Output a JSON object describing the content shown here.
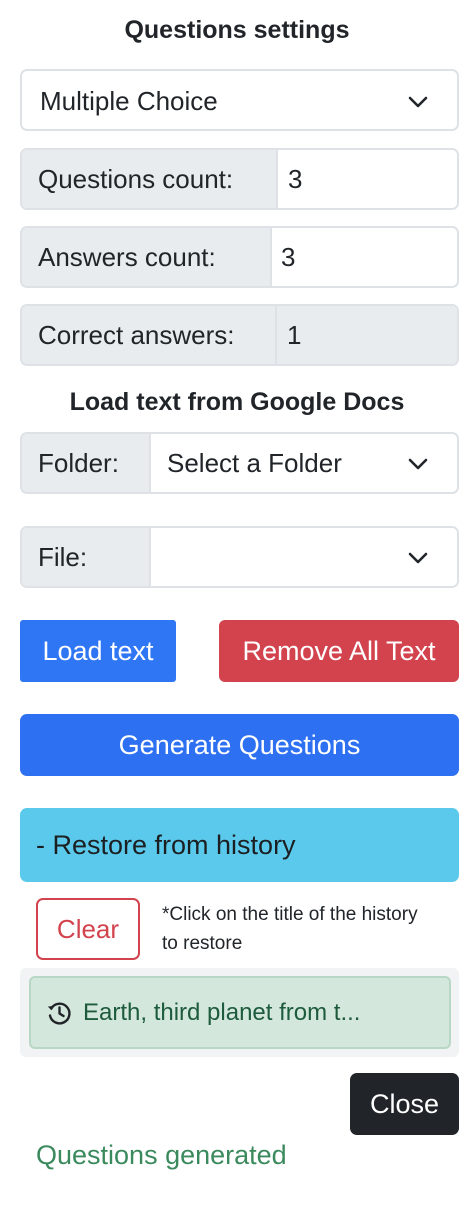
{
  "settings": {
    "title": "Questions settings",
    "question_type": "Multiple Choice",
    "questions_count_label": "Questions count:",
    "questions_count_value": "3",
    "answers_count_label": "Answers count:",
    "answers_count_value": "3",
    "correct_answers_label": "Correct answers:",
    "correct_answers_value": "1"
  },
  "docs": {
    "title": "Load text from Google Docs",
    "folder_label": "Folder:",
    "folder_value": "Select a Folder",
    "file_label": "File:",
    "file_value": ""
  },
  "actions": {
    "load_text": "Load text",
    "remove_all_text": "Remove All Text",
    "generate_questions": "Generate Questions"
  },
  "history": {
    "toggle_label": "- Restore from history",
    "clear_label": "Clear",
    "hint": "*Click on the title of the history to restore",
    "items": [
      {
        "title": "Earth, third planet from t...",
        "icon": "history-icon"
      }
    ]
  },
  "footer": {
    "close_label": "Close",
    "status": "Questions generated"
  },
  "colors": {
    "primary": "#2f76f4",
    "danger": "#d2434e",
    "info": "#5bc9eb",
    "dark": "#212529",
    "success_text": "#3b8a5d"
  }
}
